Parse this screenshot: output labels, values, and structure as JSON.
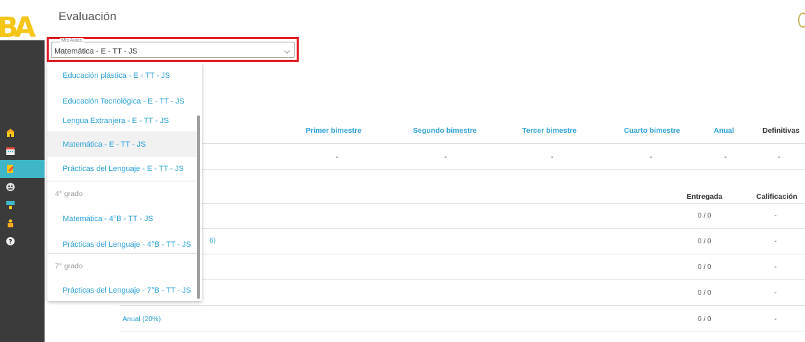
{
  "page": {
    "title": "Evaluación"
  },
  "logo": {
    "text": "BA"
  },
  "sidebar": {
    "items": [
      {
        "icon": "school-icon",
        "active": false
      },
      {
        "icon": "calendar-icon",
        "active": false
      },
      {
        "icon": "grades-icon",
        "active": true
      },
      {
        "icon": "student-face-icon",
        "active": false
      },
      {
        "icon": "teacher-icon",
        "active": false
      },
      {
        "icon": "person-icon",
        "active": false
      },
      {
        "icon": "help-icon",
        "active": false
      }
    ]
  },
  "select": {
    "label": "Mis Aulas",
    "value": "Matemática - E - TT - JS"
  },
  "dropdown": {
    "items": [
      {
        "type": "option",
        "label": "Educación plástica - E - TT - JS",
        "selected": false
      },
      {
        "type": "option",
        "label": "Educación Tecnológica - E - TT - JS",
        "selected": false
      },
      {
        "type": "option",
        "label": "Lengua Extranjera - E - TT - JS",
        "selected": false
      },
      {
        "type": "option",
        "label": "Matemática - E - TT - JS",
        "selected": true
      },
      {
        "type": "option",
        "label": "Prácticas del Lenguaje - E - TT - JS",
        "selected": false
      },
      {
        "type": "group",
        "label": "4° grado"
      },
      {
        "type": "option",
        "label": "Matemática - 4°B - TT - JS",
        "selected": false
      },
      {
        "type": "option",
        "label": "Prácticas del Lenguaje - 4°B - TT - JS",
        "selected": false
      },
      {
        "type": "group",
        "label": "7° grado"
      },
      {
        "type": "option",
        "label": "Prácticas del Lenguaje - 7°B - TT - JS",
        "selected": false
      }
    ]
  },
  "grades_table": {
    "headers": [
      "Primer bimestre",
      "Segundo bimestre",
      "Tercer bimestre",
      "Cuarto bimestre",
      "Anual",
      "Definitivas"
    ],
    "values": [
      "-",
      "-",
      "-",
      "-",
      "-",
      "-"
    ]
  },
  "assignments_table": {
    "headers": [
      "Entregada",
      "Calificación"
    ],
    "partial_label": "6)",
    "rows": [
      {
        "label": "",
        "entregada": "0 / 0",
        "calificacion": "-"
      },
      {
        "label": "",
        "entregada": "0 / 0",
        "calificacion": "-"
      },
      {
        "label": "",
        "entregada": "0 / 0",
        "calificacion": "-"
      },
      {
        "label": "",
        "entregada": "0 / 0",
        "calificacion": "-"
      },
      {
        "label": "Anual (20%)",
        "entregada": "0 / 0",
        "calificacion": "-"
      }
    ]
  },
  "colors": {
    "accent": "#2aa0d6",
    "sidebar": "#3b3b3b",
    "active": "#3fb6c8",
    "highlight": "#e01b24",
    "logo": "#f5c518"
  }
}
